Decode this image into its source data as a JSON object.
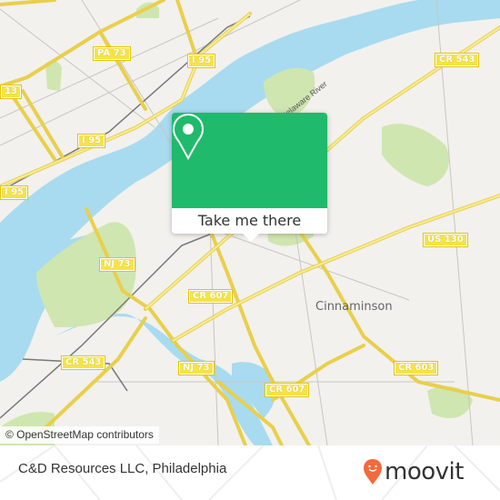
{
  "map": {
    "road_labels": [
      {
        "id": "pa73",
        "text": "PA 73"
      },
      {
        "id": "i95-top",
        "text": "I 95"
      },
      {
        "id": "i95-mid",
        "text": "I 95"
      },
      {
        "id": "i95-left",
        "text": "I 95"
      },
      {
        "id": "us13",
        "text": "13"
      },
      {
        "id": "cr543-top",
        "text": "CR 543"
      },
      {
        "id": "nj73-top",
        "text": "NJ 73"
      },
      {
        "id": "nj73-bottom",
        "text": "NJ 73"
      },
      {
        "id": "cr607-mid",
        "text": "CR 607"
      },
      {
        "id": "cr607-bottom",
        "text": "CR 607"
      },
      {
        "id": "cr543-left",
        "text": "CR 543"
      },
      {
        "id": "us130",
        "text": "US 130"
      },
      {
        "id": "cr603",
        "text": "CR 603"
      }
    ],
    "place_labels": {
      "cinnaminson": "Cinnaminson",
      "river": "Delaware River"
    },
    "attribution": "© OpenStreetMap contributors",
    "colors": {
      "land": "#f2f1ed",
      "water": "#a8dbef",
      "park": "#cfe6b0",
      "road": "#f5e34a"
    }
  },
  "popup": {
    "action_label": "Take me there",
    "icon": "map-pin-icon",
    "color": "#1fba6b"
  },
  "footer": {
    "title": "C&D Resources LLC, Philadelphia",
    "brand": "moovit",
    "brand_color": "#f26a3d"
  }
}
